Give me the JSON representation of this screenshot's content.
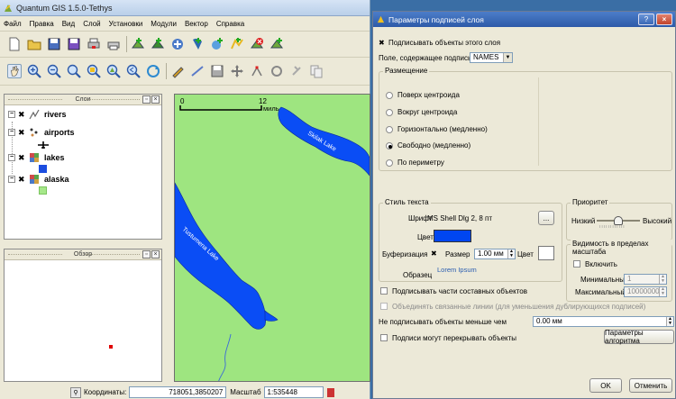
{
  "qgis": {
    "title": "Quantum GIS 1.5.0-Tethys",
    "menu": [
      "Файл",
      "Правка",
      "Вид",
      "Слой",
      "Установки",
      "Модули",
      "Вектор",
      "Справка"
    ],
    "layers_panel_title": "Слои",
    "layers": [
      {
        "name": "rivers",
        "icon": "line-layer-icon"
      },
      {
        "name": "airports",
        "icon": "point-layer-icon"
      },
      {
        "name": "lakes",
        "icon": "polygon-layer-icon"
      },
      {
        "name": "alaska",
        "icon": "polygon-layer-icon"
      }
    ],
    "overview_title": "Обзор",
    "map": {
      "scale_bar_start": "0",
      "scale_bar_end": "12",
      "scale_bar_unit": "миль",
      "lake_labels": [
        "Skilak Lake",
        "Tustumena Lake"
      ],
      "land_color": "#9ee580",
      "water_color": "#0a4df5"
    },
    "status": {
      "coords_label": "Координаты:",
      "coords_value": "718051,3850207",
      "scale_label": "Масштаб",
      "scale_value": "1:535448"
    }
  },
  "dialog": {
    "title": "Параметры подписей слоя",
    "label_layer_checkbox": "Подписывать объекты этого слоя",
    "field_label": "Поле, содержащее подпись",
    "field_value": "NAMES",
    "placement": {
      "title": "Размещение",
      "options": [
        "Поверх центроида",
        "Вокруг центроида",
        "Горизонтально (медленно)",
        "Свободно (медленно)",
        "По периметру"
      ],
      "selected": "Свободно (медленно)"
    },
    "text_style": {
      "title": "Стиль текста",
      "font_label": "Шрифт",
      "font_value": "MS Shell Dlg 2, 8 пт",
      "font_button": "...",
      "color_label": "Цвет",
      "text_color": "#0046f0",
      "buffer_label": "Буферизация",
      "size_label": "Размер",
      "size_value": "1.00 мм",
      "buffer_color_label": "Цвет",
      "sample_label": "Образец",
      "sample_text": "Lorem Ipsum"
    },
    "priority": {
      "title": "Приоритет",
      "low": "Низкий",
      "high": "Высокий",
      "value_fraction": 0.5
    },
    "scale_visibility": {
      "title": "Видимость в пределах масштаба",
      "enable_label": "Включить",
      "min_label": "Минимальный",
      "min_value": "1",
      "max_label": "Максимальный",
      "max_value": "10000000"
    },
    "label_parts": "Подписывать части составных объектов",
    "merge_lines": "Объединять связанные линии (для уменьшения дублирующихся подписей)",
    "min_size_label": "Не подписывать объекты меньше чем",
    "min_size_value": "0.00 мм",
    "overlap_label": "Подписи могут перекрывать объекты",
    "algo_button": "Параметры алгоритма",
    "ok": "OK",
    "cancel": "Отменить"
  }
}
